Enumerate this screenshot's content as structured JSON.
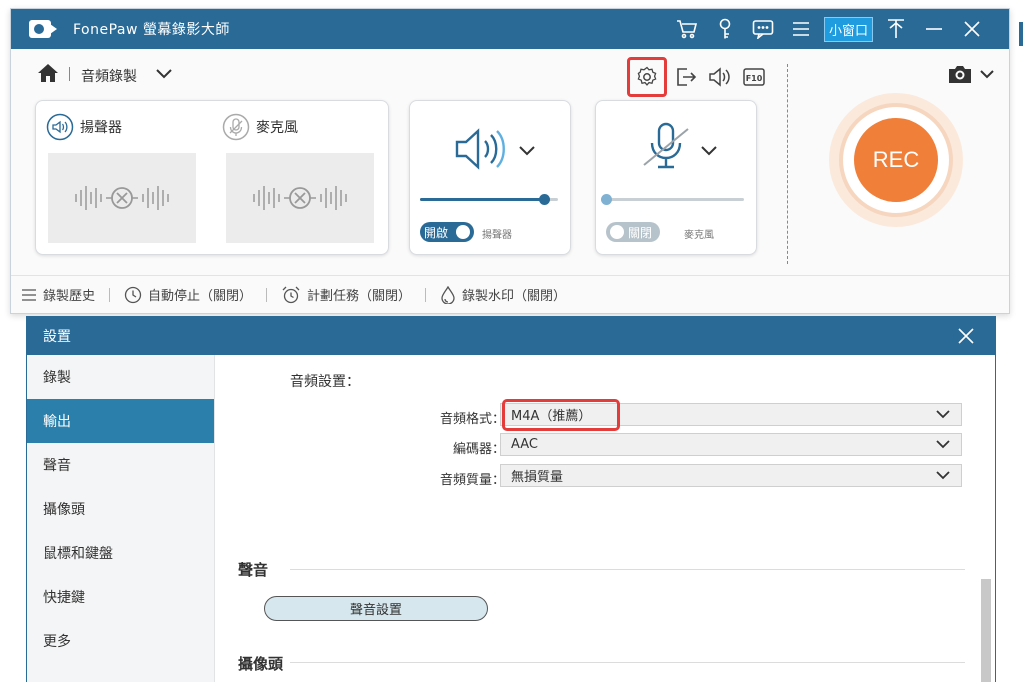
{
  "app": {
    "title": "FonePaw 螢幕錄影大師",
    "mini_window": "小窗口"
  },
  "toolbar": {
    "mode": "音頻錄製"
  },
  "sources": {
    "speaker_label": "揚聲器",
    "mic_label": "麥克風"
  },
  "speaker_panel": {
    "toggle": "開啟",
    "label": "揚聲器",
    "volume": 0.9
  },
  "mic_panel": {
    "toggle": "關閉",
    "label": "麥克風",
    "volume": 0.0
  },
  "record_button": "REC",
  "bottom_bar": [
    {
      "label": "錄製歷史",
      "icon": "list-icon"
    },
    {
      "label": "自動停止（關閉）",
      "icon": "clock-icon"
    },
    {
      "label": "計劃任務（關閉）",
      "icon": "alarm-icon"
    },
    {
      "label": "錄製水印（關閉）",
      "icon": "watermark-icon"
    }
  ],
  "settings": {
    "title": "設置",
    "sidebar": [
      "錄製",
      "輸出",
      "聲音",
      "攝像頭",
      "鼠標和鍵盤",
      "快捷鍵",
      "更多"
    ],
    "active_index": 1,
    "audio_section_title": "音頻設置：",
    "rows": [
      {
        "label": "音頻格式：",
        "value": "M4A（推薦）"
      },
      {
        "label": "編碼器：",
        "value": "AAC"
      },
      {
        "label": "音頻質量：",
        "value": "無損質量"
      }
    ],
    "sound_group": "聲音",
    "sound_button": "聲音設置",
    "camera_group": "攝像頭"
  },
  "colors": {
    "titlebar": "#2a6a96",
    "rec": "#f07f3a",
    "highlight": "#e43b3b",
    "active_side": "#2a7fab"
  }
}
